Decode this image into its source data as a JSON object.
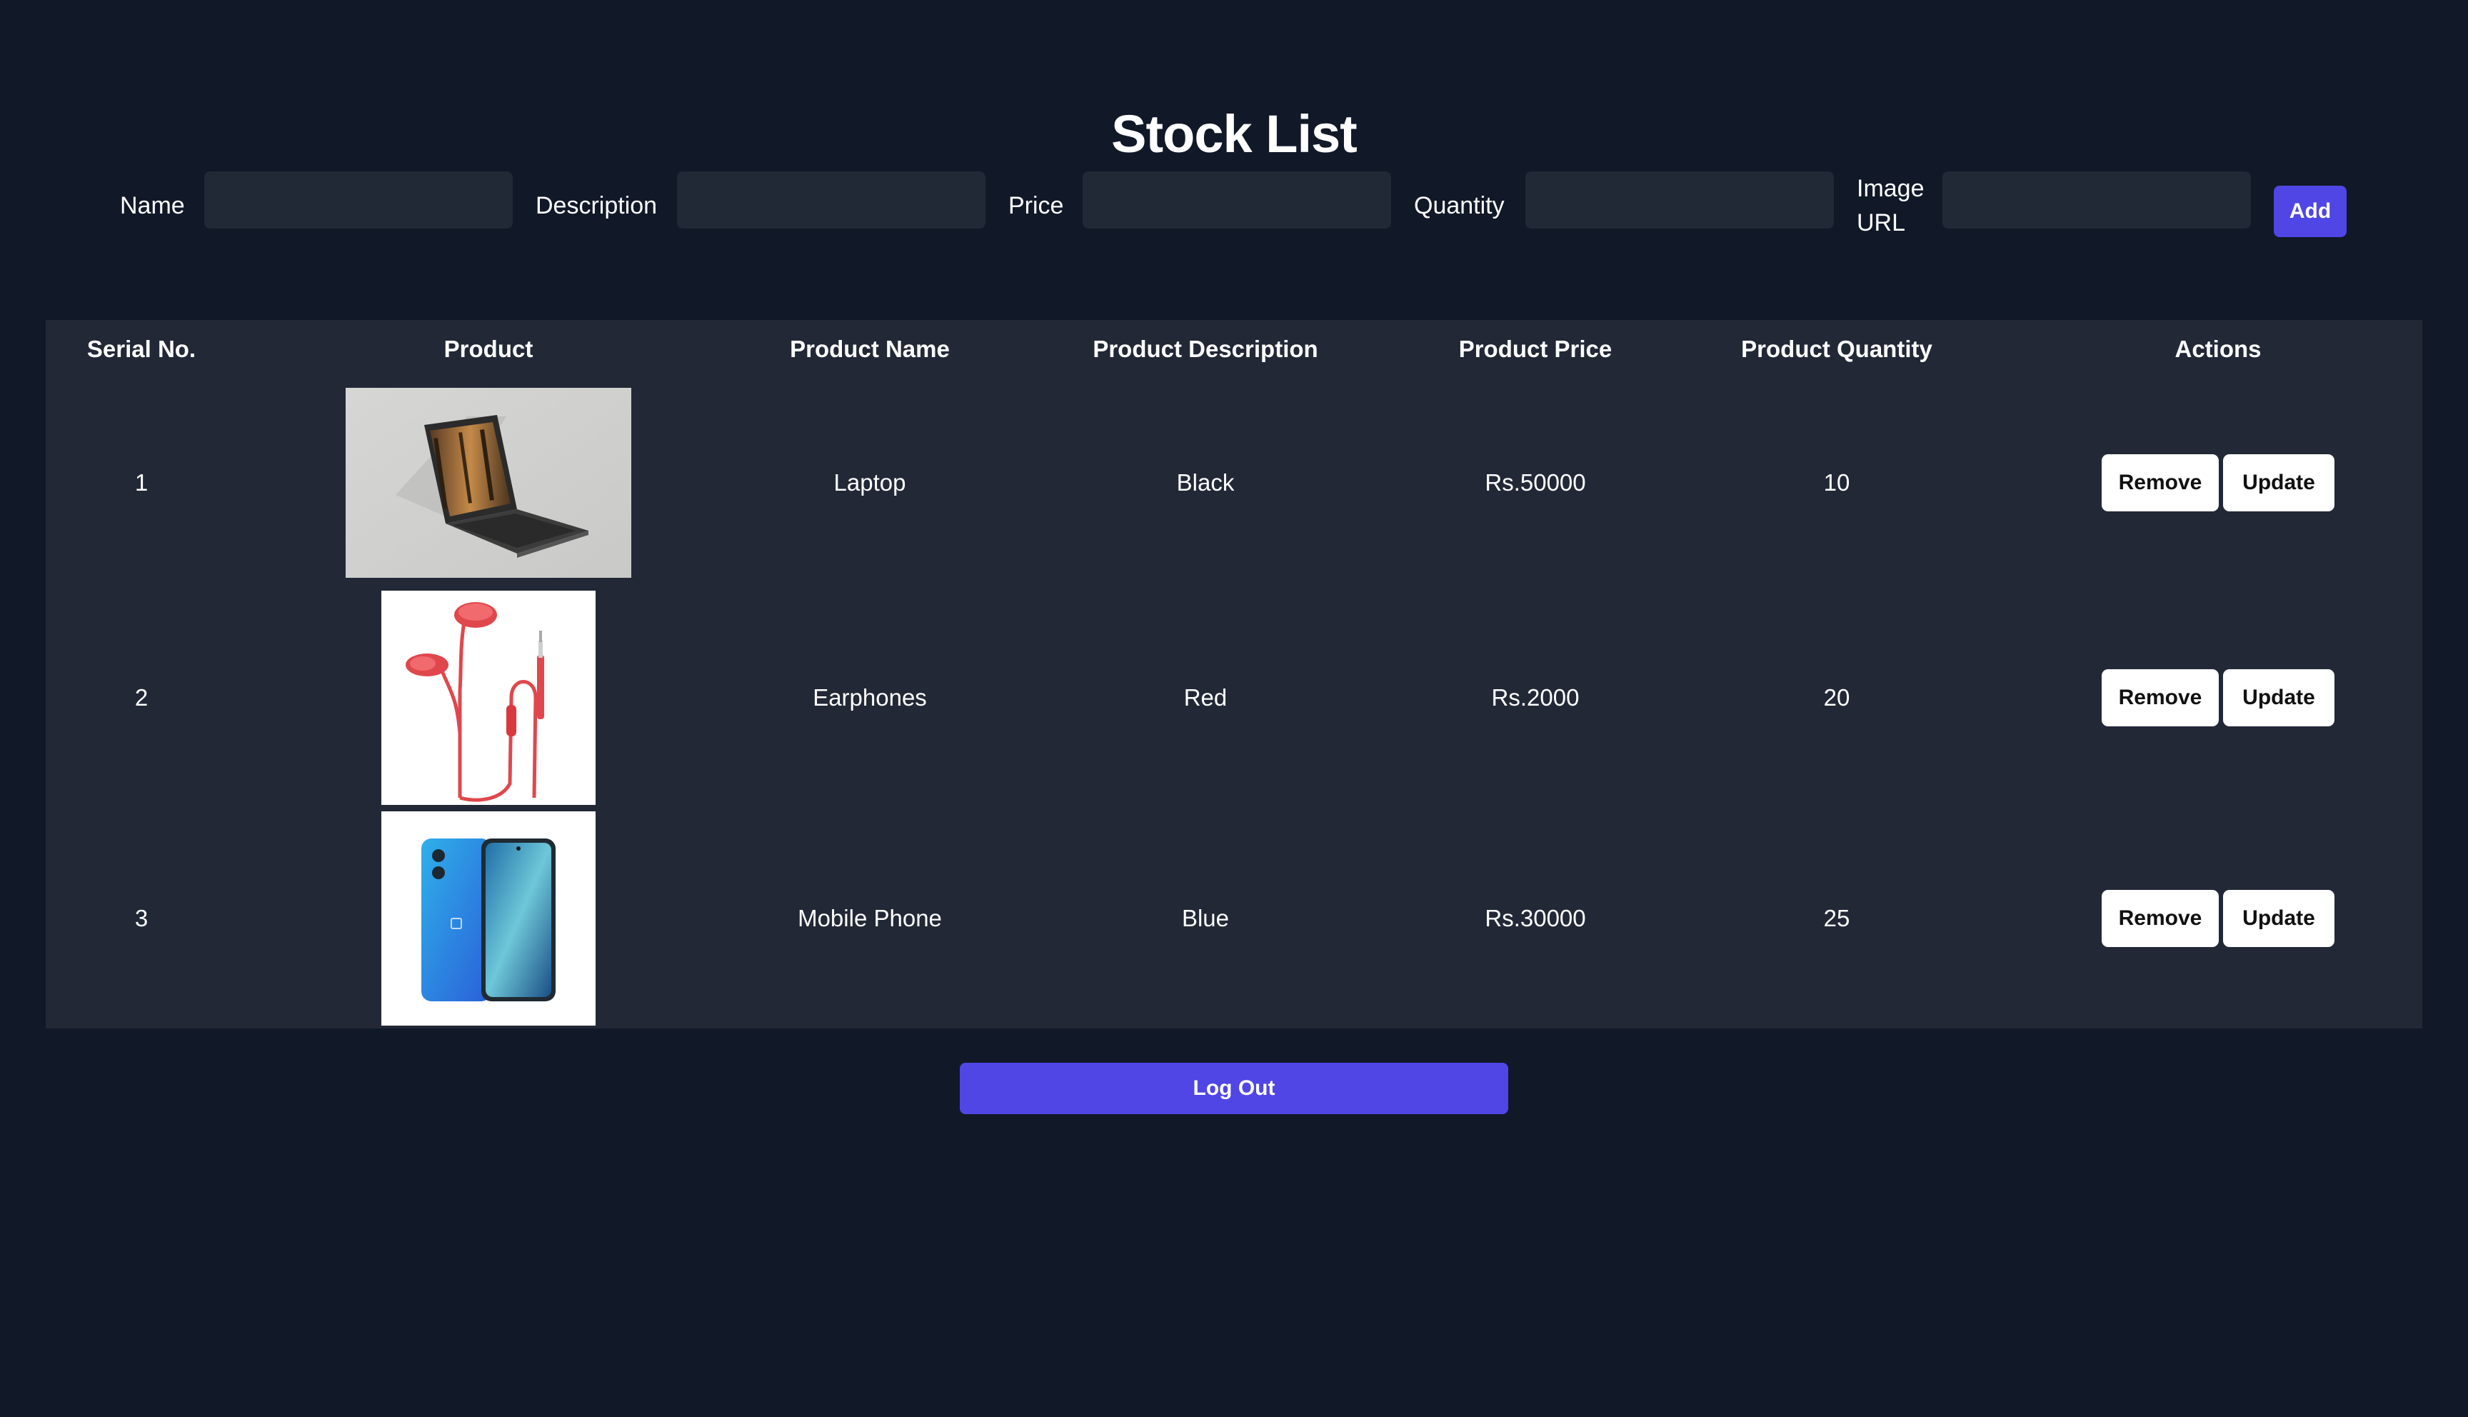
{
  "page": {
    "title": "Stock List"
  },
  "form": {
    "name_label": "Name",
    "description_label": "Description",
    "price_label": "Price",
    "quantity_label": "Quantity",
    "image_url_label_line1": "Image",
    "image_url_label_line2": "URL",
    "name_value": "",
    "description_value": "",
    "price_value": "",
    "quantity_value": "",
    "image_url_value": "",
    "add_label": "Add"
  },
  "table": {
    "headers": [
      "Serial No.",
      "Product",
      "Product Name",
      "Product Description",
      "Product Price",
      "Product Quantity",
      "Actions"
    ],
    "rows": [
      {
        "serial": "1",
        "image": "laptop-image",
        "name": "Laptop",
        "description": "Black",
        "price": "Rs.50000",
        "quantity": "10"
      },
      {
        "serial": "2",
        "image": "earphones-image",
        "name": "Earphones",
        "description": "Red",
        "price": "Rs.2000",
        "quantity": "20"
      },
      {
        "serial": "3",
        "image": "mobile-phone-image",
        "name": "Mobile Phone",
        "description": "Blue",
        "price": "Rs.30000",
        "quantity": "25"
      }
    ],
    "remove_label": "Remove",
    "update_label": "Update"
  },
  "footer": {
    "logout_label": "Log Out"
  },
  "colors": {
    "background": "#111827",
    "panel": "#222836",
    "input": "#212836",
    "accent": "#4f46e5",
    "button_light": "#ffffff"
  }
}
